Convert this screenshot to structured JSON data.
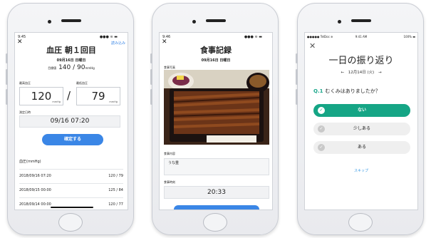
{
  "phone1": {
    "time": "9:45",
    "status_right": "●●● ≋ ▬",
    "action_link": "読み込み",
    "title": "血圧 朝１回目",
    "date": "09月16日 日曜日",
    "bp_label": "目標値",
    "bp_value": "140 / 90",
    "bp_unit": "mmHg",
    "max_label": "最高血圧",
    "min_label": "最低血圧",
    "max_value": "120",
    "min_value": "79",
    "value_unit": "mmHg",
    "separator": "/",
    "datetime_label": "測定日時",
    "datetime_value": "09/16 07:20",
    "confirm_button": "確定する",
    "history_header": "血圧(mmHg)",
    "history": [
      {
        "date": "2018/09/16 07:20",
        "value": "120 / 79"
      },
      {
        "date": "2018/09/15 00:00",
        "value": "125 / 84"
      },
      {
        "date": "2018/09/14 00:00",
        "value": "120 / 77"
      }
    ]
  },
  "phone2": {
    "time": "9:46",
    "status_right": "●●● ≋ ▬",
    "title": "食事記録",
    "date": "09月16日 日曜日",
    "photo_label": "食事写真",
    "content_label": "食事内容",
    "content_value": "うな重",
    "time_label": "食事時刻",
    "time_value": "20:33"
  },
  "phone3": {
    "carrier": "●●●●● TelDoc ≋",
    "time": "9:41 AM",
    "battery": "100% ▬",
    "title": "一日の振り返り",
    "prev_arrow": "←",
    "date": "12月14日 (火)",
    "next_arrow": "→",
    "question_number": "Q.1",
    "question": "むくみはありましたか？",
    "options": [
      "ない",
      "少しある",
      "ある"
    ],
    "check_glyph": "✓",
    "skip": "スキップ"
  },
  "close_glyph": "✕",
  "colors": {
    "accent_blue": "#3a86e6",
    "accent_green": "#15a585"
  }
}
